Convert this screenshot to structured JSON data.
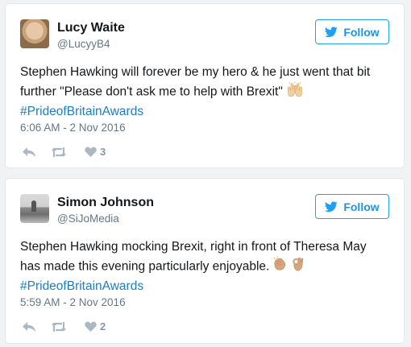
{
  "tweets": [
    {
      "author_name": "Lucy Waite",
      "handle": "@LucyyB4",
      "follow_label": "Follow",
      "text_line1": "Stephen Hawking will forever be my hero & he just went that bit",
      "text_line2": "further \"Please don't ask me to help with Brexit\"",
      "emoji": "raised-hands",
      "hashtag": "#PrideofBritainAwards",
      "timestamp": "6:06 AM - 2 Nov 2016",
      "like_count": "3"
    },
    {
      "author_name": "Simon Johnson",
      "handle": "@SiJoMedia",
      "follow_label": "Follow",
      "text_line1": "Stephen Hawking mocking Brexit, right in front of Theresa May",
      "text_line2": "has made this evening particularly enjoyable.",
      "emoji": "clapping-and-ok-hands",
      "hashtag": "#PrideofBritainAwards",
      "timestamp": "5:59 AM - 2 Nov 2016",
      "like_count": "2"
    }
  ],
  "colors": {
    "accent": "#1da1f2",
    "hashtag": "#1b7ec4",
    "muted": "#657786",
    "icon": "#aab8c2"
  }
}
